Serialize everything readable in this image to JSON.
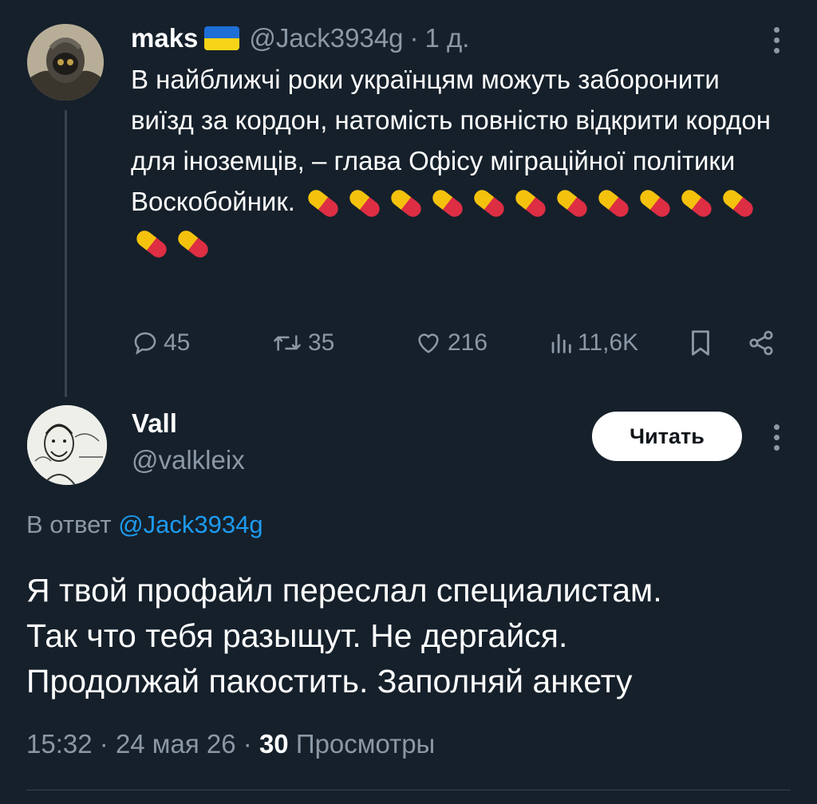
{
  "parent_tweet": {
    "author_name": "maks",
    "author_handle": "@Jack3934g",
    "separator": "·",
    "time_ago": "1 д.",
    "text": "В найближчі роки українцям можуть заборонити виїзд за кордон, натомість повністю відкрити кордон для іноземців, – глава Офісу міграційної політики Воскобойник.",
    "emoji_name": "pill-emoji",
    "emoji_count": 13,
    "actions": {
      "replies": "45",
      "retweets": "35",
      "likes": "216",
      "views": "11,6K"
    }
  },
  "reply_tweet": {
    "author_name": "Vall",
    "author_handle": "@valkleix",
    "follow_label": "Читать",
    "reply_prefix": "В ответ",
    "reply_mention": "@Jack3934g",
    "text_lines": [
      "Я твой профайл переслал специалистам.",
      "Так что тебя разыщут. Не дергайся.",
      "Продолжай пакостить. Заполняй анкету"
    ],
    "time": "15:32",
    "date": "24 мая 26",
    "separator": "·",
    "views_count": "30",
    "views_label": "Просмотры"
  },
  "colors": {
    "background": "#15202b",
    "muted_text": "#8b98a5",
    "link": "#1d9bf0",
    "divider": "#38444d"
  }
}
